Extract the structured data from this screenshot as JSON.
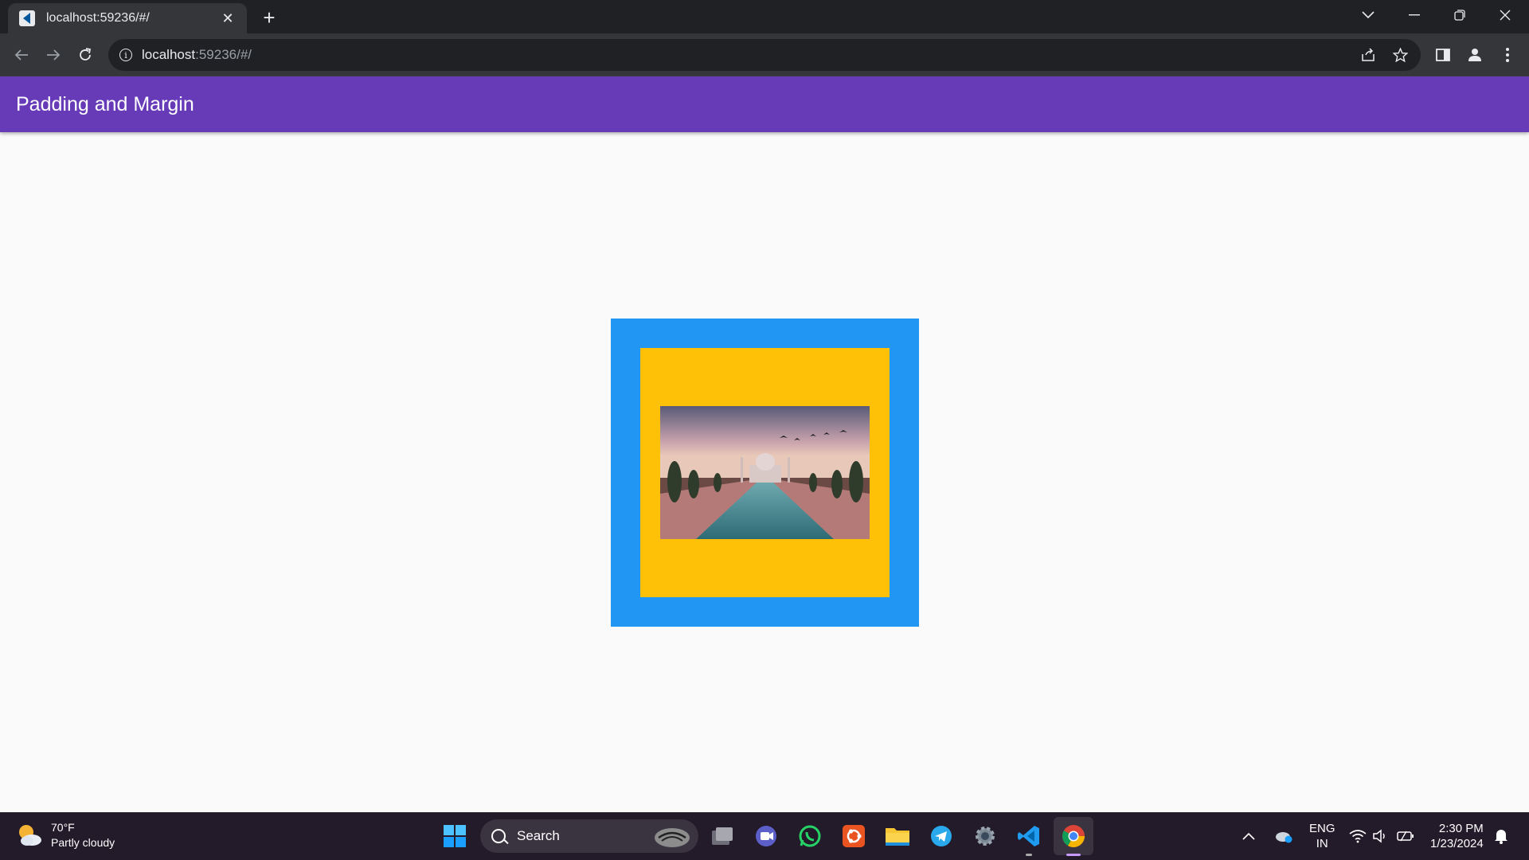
{
  "browser": {
    "tab_title": "localhost:59236/#/",
    "url_host": "localhost",
    "url_rest": ":59236/#/"
  },
  "app": {
    "title": "Padding and Margin",
    "colors": {
      "appbar": "#673ab7",
      "outer": "#2196f3",
      "inner": "#ffc107"
    },
    "image_subject": "Taj Mahal reflecting pool at sunset"
  },
  "taskbar": {
    "weather_temp": "70°F",
    "weather_desc": "Partly cloudy",
    "search_label": "Search",
    "lang_top": "ENG",
    "lang_bottom": "IN",
    "time": "2:30 PM",
    "date": "1/23/2024"
  }
}
